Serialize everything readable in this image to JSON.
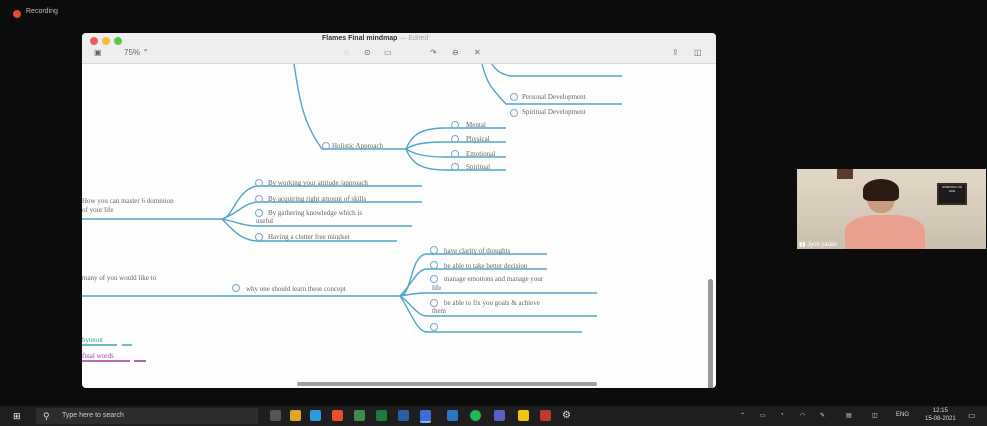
{
  "recording": {
    "label": "Recording"
  },
  "window": {
    "title": "Flames Final mindmap",
    "edited": "— Edited",
    "zoom": "75%"
  },
  "mindmap": {
    "top_nodes": [
      "Personal Development",
      "Spiritual Development"
    ],
    "holistic": {
      "label": "Holistic Approach",
      "children": [
        "Mental",
        "Physical",
        "Emotional",
        "Spiritual"
      ]
    },
    "master": {
      "label_line1": "How you can master 6 dominion",
      "label_line2": "of your life",
      "children": [
        "By working your attitude /approach",
        "By acquiring right amount of skills",
        "By gathering knowledge which is",
        "useful",
        "Having a clutter free mindset"
      ]
    },
    "why": {
      "left_label": "many of you would like to",
      "label": "why one should learn these concept",
      "children": [
        "have clarity of thoughts",
        "be able to take better decision",
        "manage emotions and manage your",
        "life",
        "be able to fix you goals & achieve",
        "them"
      ]
    },
    "bottom": [
      "hyteout",
      "final words"
    ]
  },
  "webcam": {
    "name": "Jyoti yadav",
    "poster": "WORKING ON LIFE"
  },
  "taskbar": {
    "search_placeholder": "Type here to search",
    "lang": "ENG",
    "time": "12:15",
    "date": "15-08-2021"
  },
  "colors": {
    "accent": "#4fa7c8",
    "teal": "#3aa5a5",
    "purple": "#a13aa0"
  }
}
